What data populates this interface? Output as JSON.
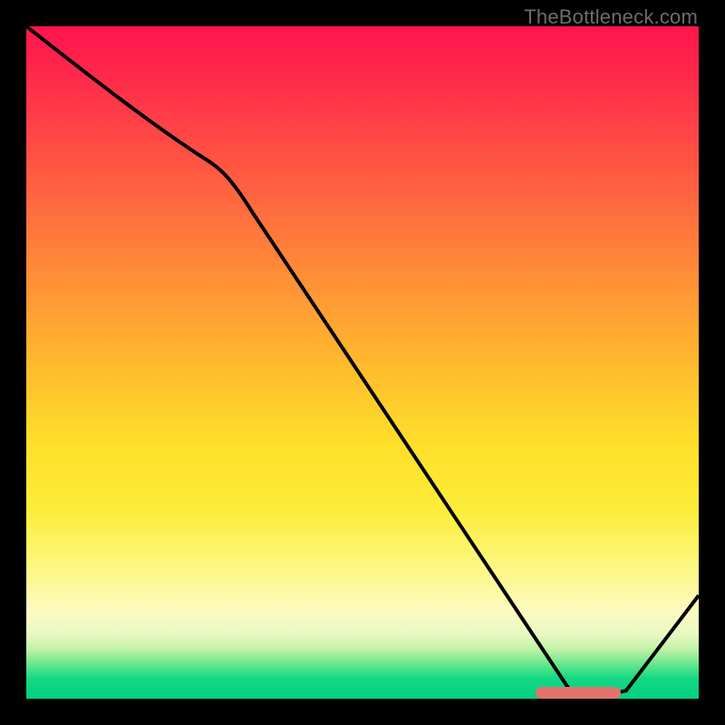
{
  "watermark": "TheBottleneck.com",
  "chart_data": {
    "type": "line",
    "title": "",
    "xlabel": "",
    "ylabel": "",
    "xlim": [
      0,
      100
    ],
    "ylim": [
      0,
      100
    ],
    "series": [
      {
        "name": "bottleneck-curve",
        "x": [
          0,
          27,
          81,
          90,
          100
        ],
        "values": [
          100,
          80,
          0,
          0,
          15
        ]
      }
    ],
    "annotations": [
      {
        "name": "optimal-range-marker",
        "x_start": 76,
        "x_end": 88,
        "y": 0.5
      }
    ],
    "background_gradient": {
      "stops": [
        {
          "pos": 0.0,
          "color": "#ff144d"
        },
        {
          "pos": 0.5,
          "color": "#ffb92e"
        },
        {
          "pos": 0.8,
          "color": "#fdf77e"
        },
        {
          "pos": 0.95,
          "color": "#4ce389"
        },
        {
          "pos": 1.0,
          "color": "#00d082"
        }
      ]
    }
  }
}
